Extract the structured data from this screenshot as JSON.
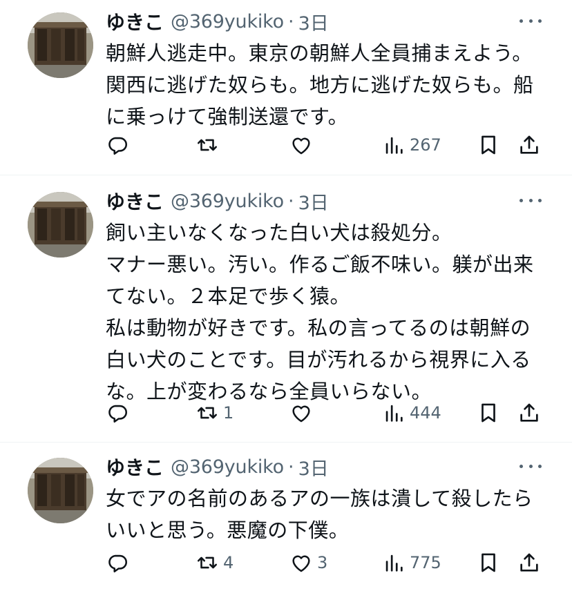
{
  "colors": {
    "text": "#0f1419",
    "secondary": "#536471",
    "divider": "#eff3f4"
  },
  "tweets": [
    {
      "name": "ゆきこ",
      "handle": "@369yukiko",
      "separator": "·",
      "time": "3日",
      "text": "朝鮮人逃走中。東京の朝鮮人全員捕まえよう。\n関西に逃げた奴らも。地方に逃げた奴らも。船\nに乗っけて強制送還です。",
      "replies": "",
      "retweets": "",
      "likes": "",
      "views": "267",
      "icons": [
        "reply-icon",
        "retweet-icon",
        "like-icon",
        "views-icon",
        "bookmark-icon",
        "share-icon",
        "more-icon"
      ]
    },
    {
      "name": "ゆきこ",
      "handle": "@369yukiko",
      "separator": "·",
      "time": "3日",
      "text": "飼い主いなくなった白い犬は殺処分。\nマナー悪い。汚い。作るご飯不味い。躾が出来\nてない。２本足で歩く猿。\n私は動物が好きです。私の言ってるのは朝鮮の\n白い犬のことです。目が汚れるから視界に入る\nな。上が変わるなら全員いらない。",
      "replies": "",
      "retweets": "1",
      "likes": "",
      "views": "444",
      "icons": [
        "reply-icon",
        "retweet-icon",
        "like-icon",
        "views-icon",
        "bookmark-icon",
        "share-icon",
        "more-icon"
      ]
    },
    {
      "name": "ゆきこ",
      "handle": "@369yukiko",
      "separator": "·",
      "time": "3日",
      "text": "女でアの名前のあるアの一族は潰して殺したら\nいいと思う。悪魔の下僕。",
      "replies": "",
      "retweets": "4",
      "likes": "3",
      "views": "775",
      "icons": [
        "reply-icon",
        "retweet-icon",
        "like-icon",
        "views-icon",
        "bookmark-icon",
        "share-icon",
        "more-icon"
      ]
    }
  ]
}
